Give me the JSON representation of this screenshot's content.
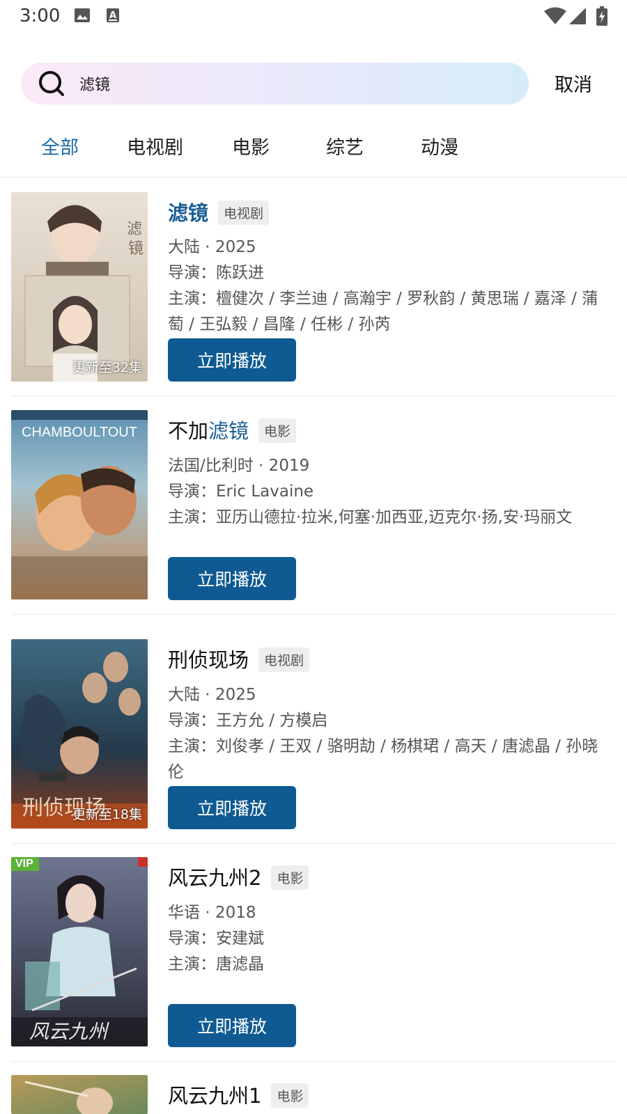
{
  "status_bar": {
    "time": "3:00",
    "icons": [
      "image-icon",
      "a-icon",
      "wifi-icon",
      "signal-icon",
      "battery-icon"
    ]
  },
  "search": {
    "query": "滤镜",
    "cancel_label": "取消"
  },
  "tabs": [
    {
      "label": "全部",
      "active": true
    },
    {
      "label": "电视剧",
      "active": false
    },
    {
      "label": "电影",
      "active": false
    },
    {
      "label": "综艺",
      "active": false
    },
    {
      "label": "动漫",
      "active": false
    }
  ],
  "colors": {
    "accent": "#1a5e94",
    "play_button": "#0f5a92",
    "tab_active": "#1f6aa5"
  },
  "results": [
    {
      "title_prefix": "",
      "title_highlight": "滤镜",
      "title_suffix": "",
      "type_tag": "电视剧",
      "region_year": "大陆 · 2025",
      "director": "导演：陈跃进",
      "cast": "主演：檀健次 / 李兰迪 / 高瀚宇 / 罗秋韵 / 黄思瑞 / 嘉泽 / 蒲萄 / 王弘毅 / 昌隆 / 任彬 / 孙芮",
      "poster_caption": "更新至32集",
      "play_label": "立即播放"
    },
    {
      "title_prefix": "不加",
      "title_highlight": "滤镜",
      "title_suffix": "",
      "type_tag": "电影",
      "region_year": "法国/比利时 · 2019",
      "director": "导演：Eric Lavaine",
      "cast": "主演：亚历山德拉·拉米,何塞·加西亚,迈克尔·扬,安·玛丽文",
      "poster_text": "CHAMBOULTOUT",
      "play_label": "立即播放"
    },
    {
      "title_prefix": "刑侦现场",
      "title_highlight": "",
      "title_suffix": "",
      "type_tag": "电视剧",
      "region_year": "大陆 · 2025",
      "director": "导演：王方允 / 方模启",
      "cast": "主演：刘俊孝 / 王双 / 骆明劼 / 杨棋珺 / 高天 / 唐滤晶 / 孙晓伦",
      "poster_caption": "更新至18集",
      "play_label": "立即播放"
    },
    {
      "title_prefix": "风云九州2",
      "title_highlight": "",
      "title_suffix": "",
      "type_tag": "电影",
      "region_year": "华语 · 2018",
      "director": "导演：安建斌",
      "cast": "主演：唐滤晶",
      "poster_badge": "VIP",
      "play_label": "立即播放"
    },
    {
      "title_prefix": "风云九州1",
      "title_highlight": "",
      "title_suffix": "",
      "type_tag": "电影"
    }
  ]
}
